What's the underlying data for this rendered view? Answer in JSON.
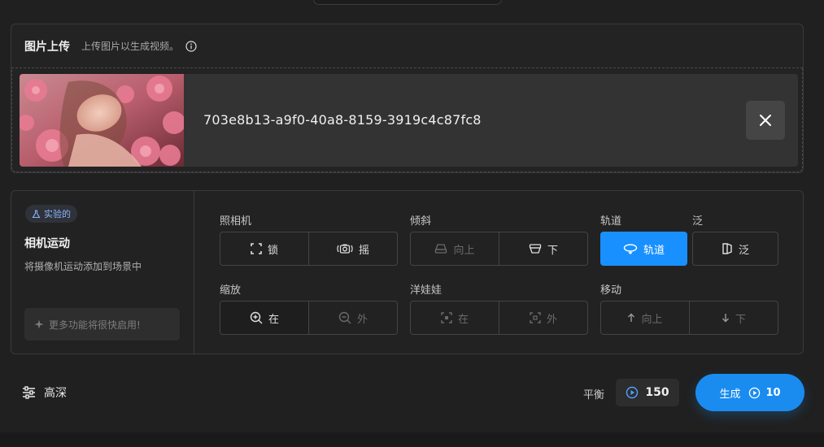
{
  "upload": {
    "title": "图片上传",
    "subtitle": "上传图片以生成视频。",
    "file_name": "703e8b13-a9f0-40a8-8159-3919c4c87fc8"
  },
  "motion": {
    "badge": "实验的",
    "title": "相机运动",
    "description": "将摄像机运动添加到场景中",
    "more_features": "更多功能将很快启用!",
    "groups": {
      "camera": {
        "label": "照相机",
        "options": [
          "锁",
          "摇"
        ]
      },
      "tilt": {
        "label": "倾斜",
        "options": [
          "向上",
          "下"
        ]
      },
      "orbit": {
        "label": "轨道",
        "option": "轨道"
      },
      "pan": {
        "label": "泛",
        "option": "泛"
      },
      "zoom": {
        "label": "缩放",
        "options": [
          "在",
          "外"
        ]
      },
      "doll": {
        "label": "洋娃娃",
        "options": [
          "在",
          "外"
        ]
      },
      "move": {
        "label": "移动",
        "options": [
          "向上",
          "下"
        ]
      }
    }
  },
  "footer": {
    "settings_label": "高深",
    "balance_label": "平衡",
    "balance_value": "150",
    "generate_label": "生成",
    "generate_cost": "10"
  },
  "colors": {
    "accent": "#1890ff",
    "background": "#202020"
  }
}
